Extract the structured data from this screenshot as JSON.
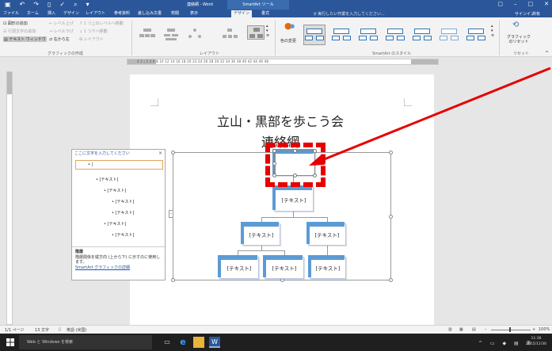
{
  "window": {
    "doc_title": "連絡網 - Word",
    "context_title": "SmartArt ツール",
    "qat": [
      "save",
      "undo",
      "redo",
      "new",
      "spelling",
      "print-preview"
    ]
  },
  "tabs": {
    "items": [
      "ファイル",
      "ホーム",
      "挿入",
      "デザイン",
      "レイアウト",
      "参考資料",
      "差し込み文書",
      "校閲",
      "表示",
      "デザイン",
      "書式"
    ],
    "active_index": 9,
    "tell_me": "♀ 実行したい作業を入力してください...",
    "signin": "サインイン",
    "share": "共有"
  },
  "ribbon": {
    "create_graphic": {
      "items": [
        "図形の追加",
        "行頭文字の追加",
        "テキスト ウィンドウ",
        "レベル上げ",
        "レベル下げ",
        "右から左",
        "1 つ上のレベルへ移動",
        "1 つ下へ移動",
        "レイアウト"
      ],
      "label": "グラフィックの作成"
    },
    "layouts_label": "レイアウト",
    "change_colors": "色の変更",
    "styles_label": "SmartArt のスタイル",
    "reset_graphic": "グラフィックのリセット",
    "reset_label": "リセット"
  },
  "ruler": {
    "numbers": "4  2  |  2  4  6  8  10  12  14  16  18  20  22  24  26  28  30  32  34  36  38  40  42  44  46  48"
  },
  "document": {
    "title": "立山・黒部を歩こう会",
    "subtitle": "連絡網"
  },
  "smartart": {
    "node_text": "[テキスト]"
  },
  "text_pane": {
    "header": "ここに文字を入力してください",
    "close": "×",
    "items": [
      {
        "level": 1,
        "text": "|"
      },
      {
        "level": 2,
        "text": "[テキスト]"
      },
      {
        "level": 3,
        "text": "[テキスト]"
      },
      {
        "level": 4,
        "text": "[テキスト]"
      },
      {
        "level": 4,
        "text": "[テキスト]"
      },
      {
        "level": 3,
        "text": "[テキスト]"
      },
      {
        "level": 4,
        "text": "[テキスト]"
      }
    ],
    "info_title": "階層",
    "info_body": "階層関係を縦方向 (上から下) に示すのに使用します。",
    "info_link": "SmartArt グラフィックの詳細"
  },
  "statusbar": {
    "page": "1/1 ページ",
    "words": "13 文字",
    "lang": "英語 (米国)",
    "zoom": "100%"
  },
  "taskbar": {
    "search": "Web と Windows を検索",
    "time": "11:36",
    "date": "2015/11/30",
    "ime": "あ"
  },
  "colors": {
    "accent": "#2b579a",
    "node_tab": "#5b9bd5",
    "annotation": "#e60000"
  }
}
